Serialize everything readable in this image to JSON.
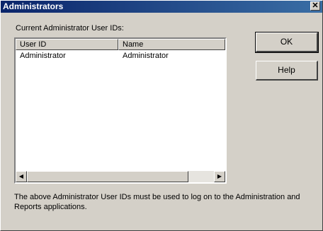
{
  "window": {
    "title": "Administrators",
    "close_glyph": "✕"
  },
  "list": {
    "label": "Current Administrator User IDs:",
    "columns": [
      "User ID",
      "Name"
    ],
    "rows": [
      {
        "user_id": "Administrator",
        "name": "Administrator"
      }
    ],
    "scroll_left_glyph": "◀",
    "scroll_right_glyph": "▶"
  },
  "buttons": {
    "ok": "OK",
    "help": "Help"
  },
  "footer": {
    "text": "The above Administrator User IDs must be used to log on to the Administration and Reports applications."
  }
}
